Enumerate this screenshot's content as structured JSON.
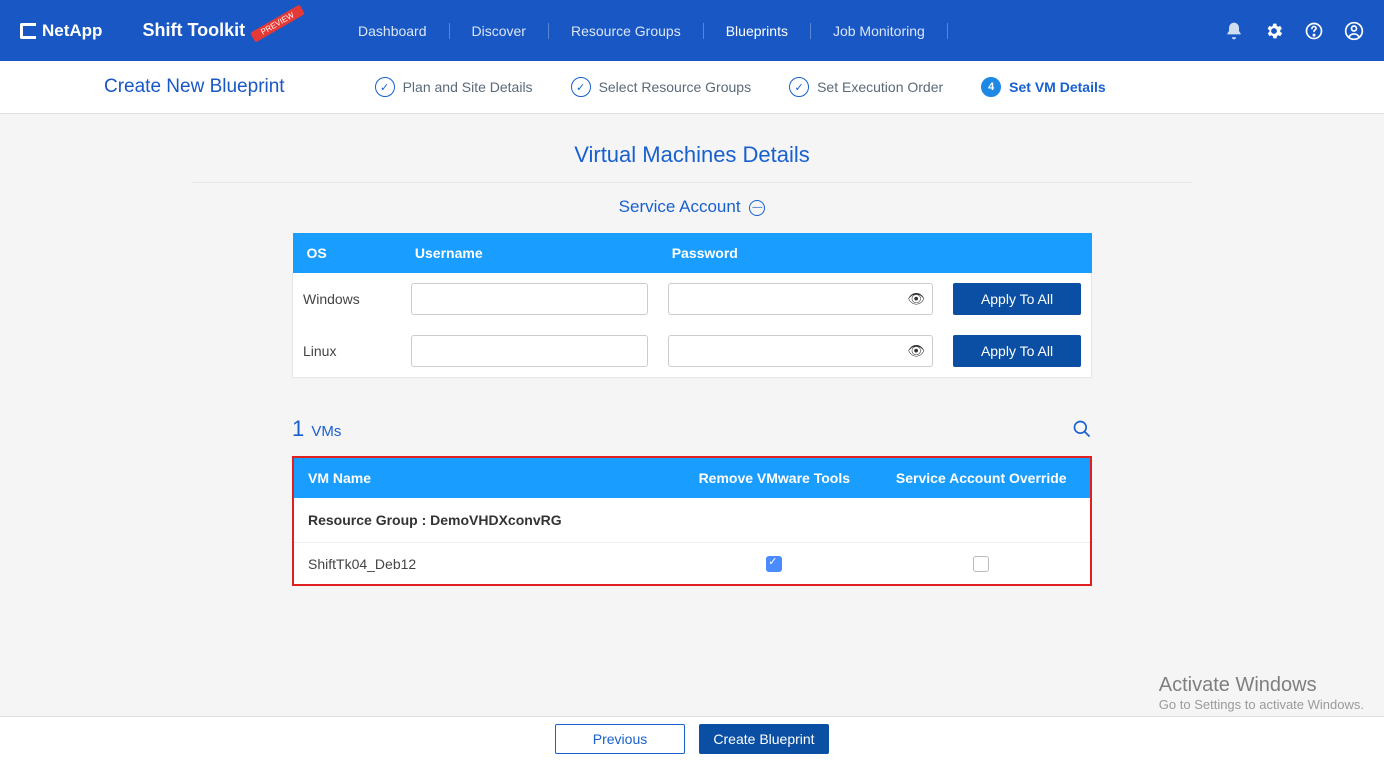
{
  "brand": "NetApp",
  "app_title": "Shift Toolkit",
  "preview_label": "PREVIEW",
  "nav": {
    "dashboard": "Dashboard",
    "discover": "Discover",
    "resource_groups": "Resource Groups",
    "blueprints": "Blueprints",
    "job_monitoring": "Job Monitoring"
  },
  "page_title": "Create New Blueprint",
  "stepper": {
    "s1": "Plan and Site Details",
    "s2": "Select Resource Groups",
    "s3": "Set Execution Order",
    "s4": "Set VM Details",
    "s4_num": "4"
  },
  "section_title": "Virtual Machines Details",
  "subsection_title": "Service Account",
  "svc_headers": {
    "os": "OS",
    "user": "Username",
    "pwd": "Password"
  },
  "svc_rows": {
    "windows": {
      "os": "Windows",
      "user": "",
      "pwd": "",
      "btn": "Apply To All"
    },
    "linux": {
      "os": "Linux",
      "user": "",
      "pwd": "",
      "btn": "Apply To All"
    }
  },
  "vm_count": {
    "num": "1",
    "label": "VMs"
  },
  "vm_headers": {
    "name": "VM Name",
    "remove": "Remove VMware Tools",
    "override": "Service Account Override"
  },
  "vm_group_label": "Resource Group : DemoVHDXconvRG",
  "vm_rows": {
    "r0": {
      "name": "ShiftTk04_Deb12",
      "remove_checked": true,
      "override_checked": false
    }
  },
  "watermark": {
    "t1": "Activate Windows",
    "t2": "Go to Settings to activate Windows."
  },
  "footer": {
    "prev": "Previous",
    "create": "Create Blueprint"
  }
}
